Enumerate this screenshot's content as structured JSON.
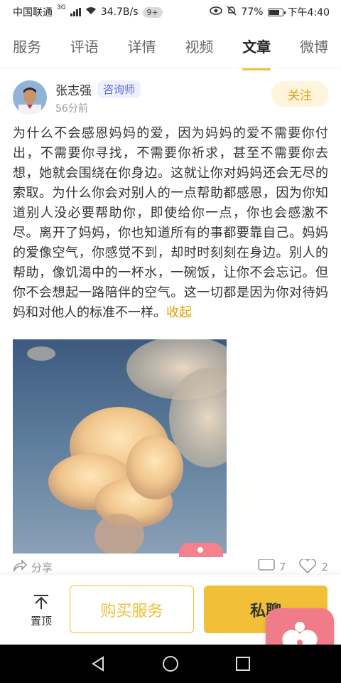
{
  "status_bar": {
    "carrier": "中国联通",
    "network": "3G",
    "speed": "34.7B/s",
    "badge": "9+",
    "battery": "77%",
    "time": "下午4:40"
  },
  "tabs": [
    {
      "label": "服务",
      "active": false
    },
    {
      "label": "评语",
      "active": false
    },
    {
      "label": "详情",
      "active": false
    },
    {
      "label": "视频",
      "active": false
    },
    {
      "label": "文章",
      "active": true
    },
    {
      "label": "微博",
      "active": false
    }
  ],
  "author": {
    "name": "张志强",
    "tag": "咨询师",
    "time": "56分前",
    "follow_label": "关注"
  },
  "article": {
    "text": "为什么不会感恩妈妈的爱，因为妈妈的爱不需要你付出，不需要你寻找，不需要你祈求，甚至不需要你去想，她就会围绕在你身边。这就让你对妈妈还会无尽的索取。为什么你会对别人的一点帮助都感恩，因为你知道别人没必要帮助你，即使给你一点，你也会感激不尽。离开了妈妈，你也知道所有的事都要靠自己。妈妈的爱像空气，你感觉不到，却时时刻刻在身边。别人的帮助，像饥渴中的一杯水，一碗饭，让你不会忘记。但你不会想起一路陪伴的空气。这一切都是因为你对待妈妈和对他人的标准不一样。",
    "collapse_label": "收起"
  },
  "interactions": {
    "share_label": "分享",
    "comment_count": "7",
    "like_count": "2"
  },
  "bottom_bar": {
    "pin_label": "置顶",
    "buy_label": "购买服务",
    "chat_label": "私聊"
  },
  "colors": {
    "accent": "#f2c038",
    "follow_text": "#e0a100",
    "tag_text": "#5a67d8",
    "heart_button": "#f07c8a"
  },
  "icons": {
    "pin": "arrow-up-to-line-icon",
    "share": "share-icon",
    "comment": "comment-icon",
    "like": "heart-icon",
    "float": "heart-person-icon",
    "nav_back": "triangle-back-icon",
    "nav_home": "circle-home-icon",
    "nav_recent": "square-recent-icon"
  }
}
